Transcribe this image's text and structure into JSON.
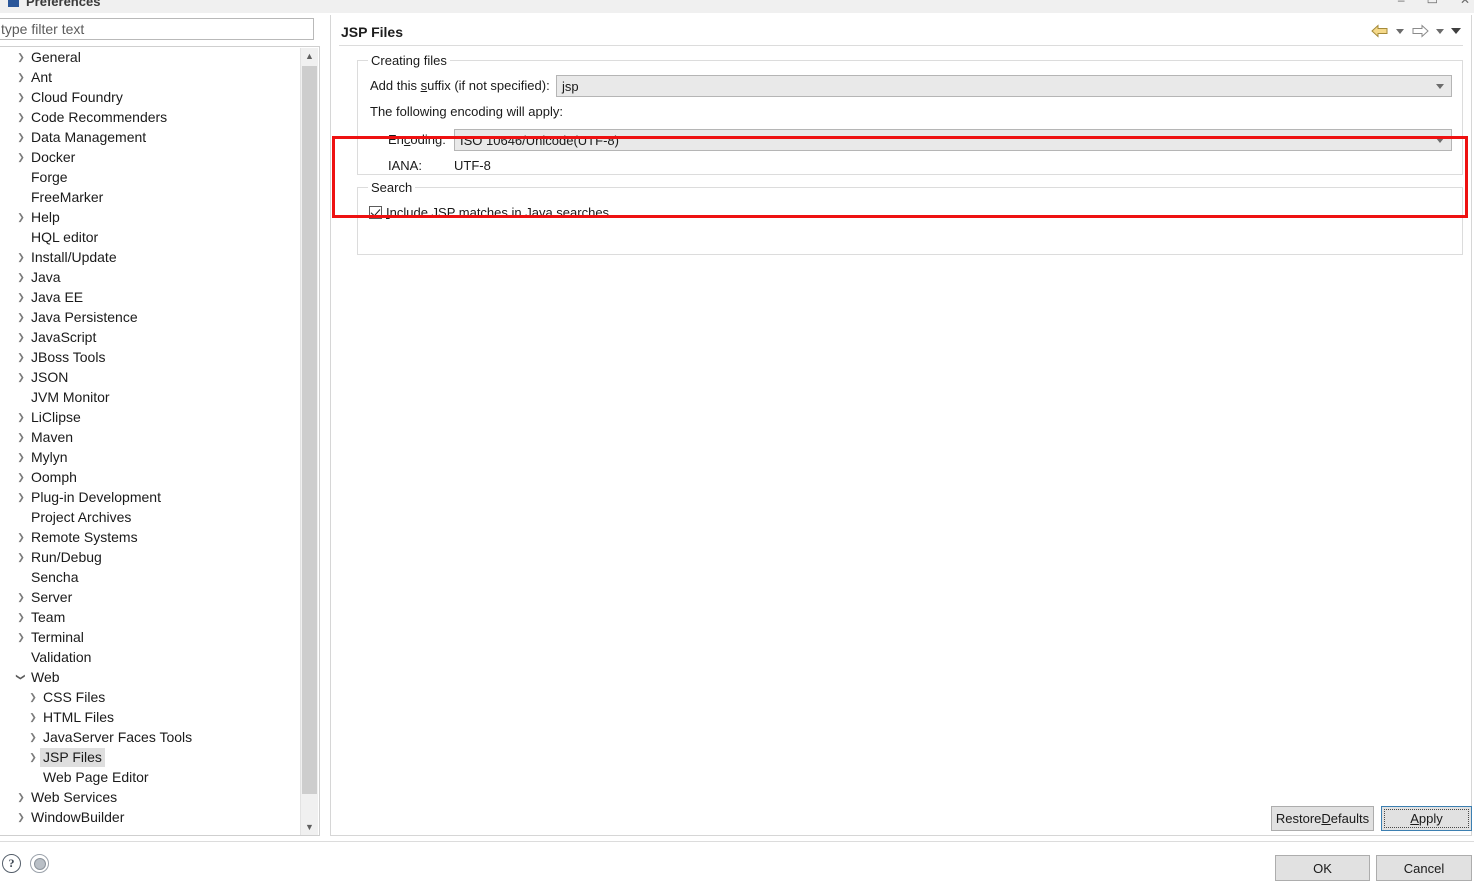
{
  "window": {
    "title": "Preferences",
    "minimize_label": "–",
    "maximize_label": "▭",
    "close_label": "✕"
  },
  "filter": {
    "placeholder": "type filter text",
    "value": ""
  },
  "tree": {
    "items": [
      {
        "label": "General",
        "depth": 1,
        "twisty": "collapsed",
        "selected": false
      },
      {
        "label": "Ant",
        "depth": 1,
        "twisty": "collapsed",
        "selected": false
      },
      {
        "label": "Cloud Foundry",
        "depth": 1,
        "twisty": "collapsed",
        "selected": false
      },
      {
        "label": "Code Recommenders",
        "depth": 1,
        "twisty": "collapsed",
        "selected": false
      },
      {
        "label": "Data Management",
        "depth": 1,
        "twisty": "collapsed",
        "selected": false
      },
      {
        "label": "Docker",
        "depth": 1,
        "twisty": "collapsed",
        "selected": false
      },
      {
        "label": "Forge",
        "depth": 1,
        "twisty": "none",
        "selected": false
      },
      {
        "label": "FreeMarker",
        "depth": 1,
        "twisty": "none",
        "selected": false
      },
      {
        "label": "Help",
        "depth": 1,
        "twisty": "collapsed",
        "selected": false
      },
      {
        "label": "HQL editor",
        "depth": 1,
        "twisty": "none",
        "selected": false
      },
      {
        "label": "Install/Update",
        "depth": 1,
        "twisty": "collapsed",
        "selected": false
      },
      {
        "label": "Java",
        "depth": 1,
        "twisty": "collapsed",
        "selected": false
      },
      {
        "label": "Java EE",
        "depth": 1,
        "twisty": "collapsed",
        "selected": false
      },
      {
        "label": "Java Persistence",
        "depth": 1,
        "twisty": "collapsed",
        "selected": false
      },
      {
        "label": "JavaScript",
        "depth": 1,
        "twisty": "collapsed",
        "selected": false
      },
      {
        "label": "JBoss Tools",
        "depth": 1,
        "twisty": "collapsed",
        "selected": false
      },
      {
        "label": "JSON",
        "depth": 1,
        "twisty": "collapsed",
        "selected": false
      },
      {
        "label": "JVM Monitor",
        "depth": 1,
        "twisty": "none",
        "selected": false
      },
      {
        "label": "LiClipse",
        "depth": 1,
        "twisty": "collapsed",
        "selected": false
      },
      {
        "label": "Maven",
        "depth": 1,
        "twisty": "collapsed",
        "selected": false
      },
      {
        "label": "Mylyn",
        "depth": 1,
        "twisty": "collapsed",
        "selected": false
      },
      {
        "label": "Oomph",
        "depth": 1,
        "twisty": "collapsed",
        "selected": false
      },
      {
        "label": "Plug-in Development",
        "depth": 1,
        "twisty": "collapsed",
        "selected": false
      },
      {
        "label": "Project Archives",
        "depth": 1,
        "twisty": "none",
        "selected": false
      },
      {
        "label": "Remote Systems",
        "depth": 1,
        "twisty": "collapsed",
        "selected": false
      },
      {
        "label": "Run/Debug",
        "depth": 1,
        "twisty": "collapsed",
        "selected": false
      },
      {
        "label": "Sencha",
        "depth": 1,
        "twisty": "none",
        "selected": false
      },
      {
        "label": "Server",
        "depth": 1,
        "twisty": "collapsed",
        "selected": false
      },
      {
        "label": "Team",
        "depth": 1,
        "twisty": "collapsed",
        "selected": false
      },
      {
        "label": "Terminal",
        "depth": 1,
        "twisty": "collapsed",
        "selected": false
      },
      {
        "label": "Validation",
        "depth": 1,
        "twisty": "none",
        "selected": false
      },
      {
        "label": "Web",
        "depth": 1,
        "twisty": "expanded",
        "selected": false
      },
      {
        "label": "CSS Files",
        "depth": 2,
        "twisty": "collapsed",
        "selected": false
      },
      {
        "label": "HTML Files",
        "depth": 2,
        "twisty": "collapsed",
        "selected": false
      },
      {
        "label": "JavaServer Faces Tools",
        "depth": 2,
        "twisty": "collapsed",
        "selected": false
      },
      {
        "label": "JSP Files",
        "depth": 2,
        "twisty": "collapsed",
        "selected": true
      },
      {
        "label": "Web Page Editor",
        "depth": 2,
        "twisty": "none",
        "selected": false
      },
      {
        "label": "Web Services",
        "depth": 1,
        "twisty": "collapsed",
        "selected": false
      },
      {
        "label": "WindowBuilder",
        "depth": 1,
        "twisty": "collapsed",
        "selected": false
      }
    ]
  },
  "page": {
    "title": "JSP Files",
    "nav": {
      "back_icon": "back-arrow-icon",
      "forward_icon": "forward-arrow-icon",
      "menu_icon": "view-menu-icon"
    },
    "creating_files": {
      "group_title": "Creating files",
      "suffix_label_before": "Add this ",
      "suffix_label_mnemonic": "s",
      "suffix_label_after": "uffix (if not specified):",
      "suffix_value": "jsp",
      "encoding_note": "The following encoding will apply:",
      "encoding_label_before": "En",
      "encoding_label_mnemonic": "c",
      "encoding_label_after": "oding:",
      "encoding_value": "ISO 10646/Unicode(UTF-8)",
      "iana_label": "IANA:",
      "iana_value": "UTF-8"
    },
    "search": {
      "group_title": "Search",
      "include_jsp_before": "",
      "include_jsp_mnemonic": "I",
      "include_jsp_after": "nclude JSP matches in Java searches",
      "include_jsp_checked": true
    }
  },
  "buttons": {
    "restore_before": "Restore ",
    "restore_mnemonic": "D",
    "restore_after": "efaults",
    "apply_before": "",
    "apply_mnemonic": "A",
    "apply_after": "pply",
    "ok": "OK",
    "cancel": "Cancel"
  },
  "corner": {
    "help_glyph": "?",
    "help_name": "help-icon",
    "filter_name": "advanced-filter-icon"
  },
  "colors": {
    "annotation_red": "#ee1111",
    "selection_gray": "#dedede",
    "focus_blue": "#3c7fb1"
  }
}
